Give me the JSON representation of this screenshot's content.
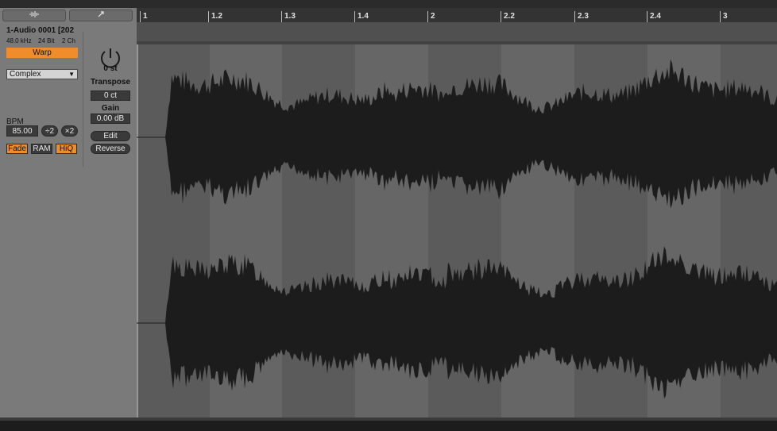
{
  "tabs": {
    "clip_icon": "waveform-icon",
    "envelope_icon": "envelope-icon"
  },
  "clip": {
    "name": "1-Audio 0001 [202",
    "sample_rate": "48.0 kHz",
    "bit_depth": "24 Bit",
    "channels": "2 Ch",
    "warp_label": "Warp",
    "warp_mode": "Complex",
    "bpm_label": "BPM",
    "bpm_value": "85.00",
    "halve_label": "÷2",
    "double_label": "×2",
    "fade_label": "Fade",
    "ram_label": "RAM",
    "hiq_label": "HiQ"
  },
  "sample": {
    "transpose_value": "0 st",
    "transpose_label": "Transpose",
    "detune_value": "0 ct",
    "gain_label": "Gain",
    "gain_value": "0.00 dB",
    "edit_label": "Edit",
    "reverse_label": "Reverse"
  },
  "ruler": [
    "1",
    "1.2",
    "1.3",
    "1.4",
    "2",
    "2.2",
    "2.3",
    "2.4",
    "3"
  ],
  "colors": {
    "accent": "#f08c2a",
    "panel": "#7a7a7a",
    "waveform": "#1c1c1c"
  }
}
